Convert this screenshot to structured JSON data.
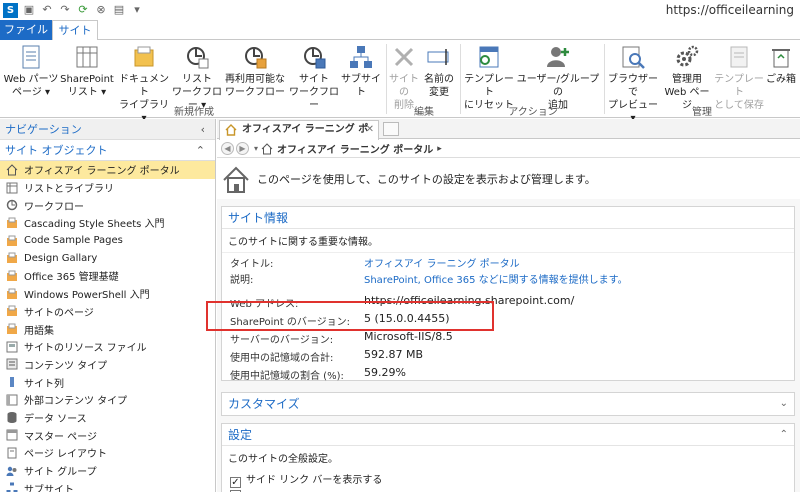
{
  "titlebar": {
    "url": "https://officeilearning"
  },
  "tabs": {
    "file": "ファイル",
    "site": "サイト"
  },
  "ribbon": {
    "buttons": [
      {
        "line1": "Web パーツ",
        "line2": "ページ ▾"
      },
      {
        "line1": "SharePoint",
        "line2": "リスト ▾"
      },
      {
        "line1": "ドキュメント",
        "line2": "ライブラリ ▾"
      },
      {
        "line1": "リスト",
        "line2": "ワークフロー ▾"
      },
      {
        "line1": "再利用可能な",
        "line2": "ワークフロー"
      },
      {
        "line1": "サイト",
        "line2": "ワークフロー"
      },
      {
        "line1": "サブサイト",
        "line2": ""
      },
      {
        "line1": "サイトの",
        "line2": "削除"
      },
      {
        "line1": "名前の",
        "line2": "変更"
      },
      {
        "line1": "テンプレート",
        "line2": "にリセット"
      },
      {
        "line1": "ユーザー/グループの",
        "line2": "追加"
      },
      {
        "line1": "ブラウザーで",
        "line2": "プレビュー ▾"
      },
      {
        "line1": "管理用",
        "line2": "Web ページ"
      },
      {
        "line1": "テンプレート",
        "line2": "として保存"
      },
      {
        "line1": "ごみ箱",
        "line2": ""
      }
    ],
    "groups": {
      "new": "新規作成",
      "edit": "編集",
      "action": "アクション",
      "manage": "管理"
    }
  },
  "nav": {
    "header": "ナビゲーション",
    "section": "サイト オブジェクト",
    "items": [
      "オフィスアイ ラーニング ポータル",
      "リストとライブラリ",
      "ワークフロー",
      "Cascading Style Sheets 入門",
      "Code Sample Pages",
      "Design Gallary",
      "Office 365 管理基礎",
      "Windows PowerShell 入門",
      "サイトのページ",
      "用語集",
      "サイトのリソース ファイル",
      "コンテンツ タイプ",
      "サイト列",
      "外部コンテンツ タイプ",
      "データ ソース",
      "マスター ページ",
      "ページ レイアウト",
      "サイト グループ",
      "サブサイト"
    ]
  },
  "doctab": {
    "label": "オフィスアイ ラーニング ポータル"
  },
  "breadcrumb": {
    "label": "オフィスアイ ラーニング ポータル"
  },
  "intro": {
    "text": "このページを使用して、このサイトの設定を表示および管理します。"
  },
  "siteinfo": {
    "title": "サイト情報",
    "desc": "このサイトに関する重要な情報。",
    "rows": [
      {
        "label": "タイトル:",
        "value": "オフィスアイ ラーニング ポータル"
      },
      {
        "label": "説明:",
        "value": "SharePoint, Office 365 などに関する情報を提供します。"
      },
      {
        "label": "Web アドレス:",
        "value": "https://officeilearning.sharepoint.com/"
      },
      {
        "label": "SharePoint のバージョン:",
        "value": "5 (15.0.0.4455)"
      },
      {
        "label": "サーバーのバージョン:",
        "value": "Microsoft-IIS/8.5"
      },
      {
        "label": "使用中の記憶域の合計:",
        "value": "592.87 MB"
      },
      {
        "label": "使用中記憶域の割合 (%):",
        "value": "59.29%"
      }
    ]
  },
  "customize": {
    "title": "カスタマイズ"
  },
  "settings": {
    "title": "設定",
    "desc": "このサイトの全般設定。",
    "option1": "サイド リンク バーを表示する"
  }
}
